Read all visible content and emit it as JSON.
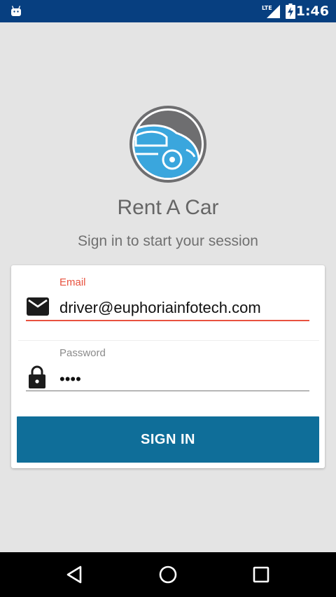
{
  "status_bar": {
    "network": "LTE",
    "time": "1:46"
  },
  "app": {
    "title": "Rent A Car",
    "subtitle": "Sign in to start your session"
  },
  "form": {
    "email_label": "Email",
    "email_value": "driver@euphoriainfotech.com",
    "password_label": "Password",
    "password_value": "••••",
    "sign_in_label": "SIGN IN"
  },
  "colors": {
    "status_bar": "#073f80",
    "accent_error": "#e8523f",
    "button": "#0f6e99",
    "logo_blue": "#3aa6dd",
    "logo_gray": "#6e6e70"
  },
  "icons": {
    "status_left": "android-icon",
    "signal": "lte-signal-icon",
    "battery": "battery-charging-icon",
    "email": "mail-icon",
    "password": "lock-icon",
    "nav": [
      "back-icon",
      "home-icon",
      "recents-icon"
    ]
  }
}
